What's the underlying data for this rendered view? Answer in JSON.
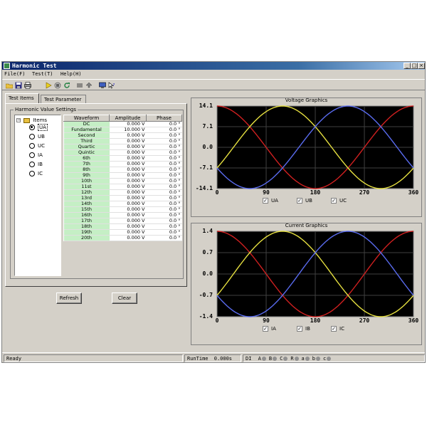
{
  "window": {
    "title": "Harmonic Test",
    "min": "_",
    "max": "□",
    "close": "×"
  },
  "menu": [
    "File(F)",
    "Test(T)",
    "Help(H)"
  ],
  "toolbar_icons": [
    "open-icon",
    "save-icon",
    "print-icon",
    "play-icon",
    "stop-icon",
    "reset-icon",
    "filter-icon",
    "upload-icon",
    "monitor-icon",
    "help-cursor-icon"
  ],
  "tabs": [
    "Test Items",
    "Test Parameter"
  ],
  "group_title": "Harmonic Value Settings",
  "tree": {
    "root": "Items",
    "items": [
      "UA",
      "UB",
      "UC",
      "IA",
      "IB",
      "IC"
    ],
    "selected": "UA"
  },
  "table": {
    "headers": [
      "Waveform",
      "Amplitude",
      "Phase"
    ],
    "rows": [
      [
        "DC",
        "0.000 V",
        "0.0 °"
      ],
      [
        "Fundamental",
        "10.000 V",
        "0.0 °"
      ],
      [
        "Second",
        "0.000 V",
        "0.0 °"
      ],
      [
        "Third",
        "0.000 V",
        "0.0 °"
      ],
      [
        "Quartic",
        "0.000 V",
        "0.0 °"
      ],
      [
        "Quintic",
        "0.000 V",
        "0.0 °"
      ],
      [
        "6th",
        "0.000 V",
        "0.0 °"
      ],
      [
        "7th",
        "0.000 V",
        "0.0 °"
      ],
      [
        "8th",
        "0.000 V",
        "0.0 °"
      ],
      [
        "9th",
        "0.000 V",
        "0.0 °"
      ],
      [
        "10th",
        "0.000 V",
        "0.0 °"
      ],
      [
        "11st",
        "0.000 V",
        "0.0 °"
      ],
      [
        "12th",
        "0.000 V",
        "0.0 °"
      ],
      [
        "13rd",
        "0.000 V",
        "0.0 °"
      ],
      [
        "14th",
        "0.000 V",
        "0.0 °"
      ],
      [
        "15th",
        "0.000 V",
        "0.0 °"
      ],
      [
        "16th",
        "0.000 V",
        "0.0 °"
      ],
      [
        "17th",
        "0.000 V",
        "0.0 °"
      ],
      [
        "18th",
        "0.000 V",
        "0.0 °"
      ],
      [
        "19th",
        "0.000 V",
        "0.0 °"
      ],
      [
        "20th",
        "0.000 V",
        "0.0 °"
      ]
    ]
  },
  "buttons": {
    "refresh": "Refresh",
    "clear": "Clear"
  },
  "chart_data": [
    {
      "type": "line",
      "title": "Voltage Graphics",
      "xlim": [
        0,
        360
      ],
      "ylim": [
        -14.1,
        14.1
      ],
      "xticks": [
        "0",
        "90",
        "180",
        "270",
        "360"
      ],
      "yticks": [
        "14.1",
        "7.1",
        "0.0",
        "-7.1",
        "-14.1"
      ],
      "background": "#000000",
      "grid": true,
      "series": [
        {
          "name": "UA",
          "color": "#d02020",
          "amplitude": 14.1,
          "phase_deg": 0
        },
        {
          "name": "UB",
          "color": "#e6e040",
          "amplitude": 14.1,
          "phase_deg": -120
        },
        {
          "name": "UC",
          "color": "#5a6cf0",
          "amplitude": 14.1,
          "phase_deg": 120
        }
      ],
      "legend_position": "bottom"
    },
    {
      "type": "line",
      "title": "Current Graphics",
      "xlim": [
        0,
        360
      ],
      "ylim": [
        -1.4,
        1.4
      ],
      "xticks": [
        "0",
        "90",
        "180",
        "270",
        "360"
      ],
      "yticks": [
        "1.4",
        "0.7",
        "0.0",
        "-0.7",
        "-1.4"
      ],
      "background": "#000000",
      "grid": true,
      "series": [
        {
          "name": "IA",
          "color": "#d02020",
          "amplitude": 1.4,
          "phase_deg": 0
        },
        {
          "name": "IB",
          "color": "#e6e040",
          "amplitude": 1.4,
          "phase_deg": -120
        },
        {
          "name": "IC",
          "color": "#5a6cf0",
          "amplitude": 1.4,
          "phase_deg": 120
        }
      ],
      "legend_position": "bottom"
    }
  ],
  "status": {
    "state": "Ready",
    "runtime_label": "RunTime",
    "runtime_value": "0.000s",
    "di_label": "DI",
    "di_channels": [
      "A",
      "B",
      "C",
      "R",
      "a",
      "b",
      "c"
    ]
  }
}
